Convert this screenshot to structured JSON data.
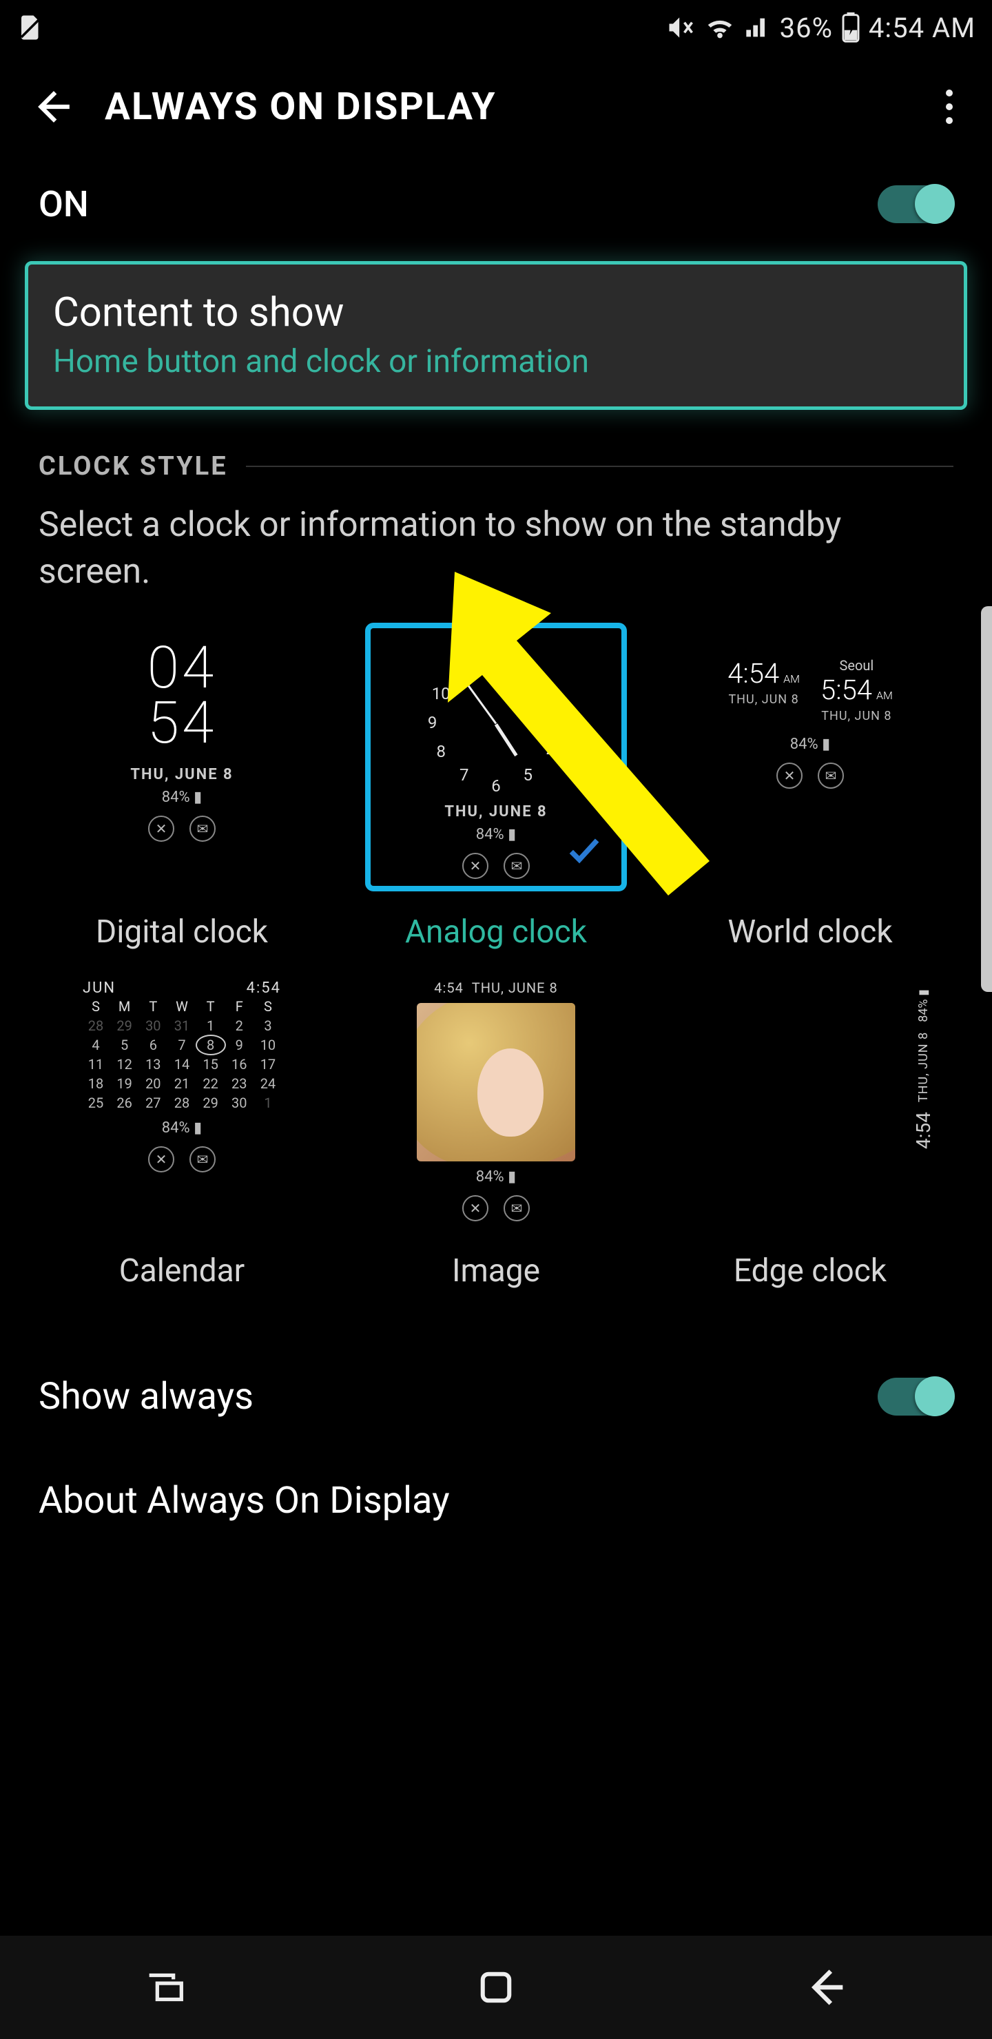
{
  "statusbar": {
    "battery_pct": "36%",
    "time": "4:54 AM"
  },
  "appbar": {
    "title": "ALWAYS ON DISPLAY"
  },
  "main_toggle": {
    "label": "ON",
    "enabled": true
  },
  "content_to_show": {
    "title": "Content to show",
    "subtitle": "Home button and clock or information"
  },
  "section": {
    "label": "CLOCK STYLE",
    "description": "Select a clock or information to show on the standby screen."
  },
  "preview_common": {
    "date": "THU, JUNE 8",
    "date_short": "THU, JUN 8",
    "battery": "84%"
  },
  "styles": [
    {
      "key": "digital",
      "label": "Digital clock",
      "selected": false,
      "time_h": "04",
      "time_m": "54"
    },
    {
      "key": "analog",
      "label": "Analog clock",
      "selected": true
    },
    {
      "key": "world",
      "label": "World clock",
      "selected": false,
      "left": {
        "city": "",
        "time": "4:54",
        "ampm": "AM",
        "date": "THU, JUN 8"
      },
      "right": {
        "city": "Seoul",
        "time": "5:54",
        "ampm": "AM",
        "date": "THU, JUN 8"
      }
    },
    {
      "key": "calendar",
      "label": "Calendar",
      "selected": false,
      "month": "JUN",
      "time": "4:54",
      "dow": [
        "S",
        "M",
        "T",
        "W",
        "T",
        "F",
        "S"
      ],
      "rows": [
        [
          "28",
          "29",
          "30",
          "31",
          "1",
          "2",
          "3"
        ],
        [
          "4",
          "5",
          "6",
          "7",
          "8",
          "9",
          "10"
        ],
        [
          "11",
          "12",
          "13",
          "14",
          "15",
          "16",
          "17"
        ],
        [
          "18",
          "19",
          "20",
          "21",
          "22",
          "23",
          "24"
        ],
        [
          "25",
          "26",
          "27",
          "28",
          "29",
          "30",
          "1"
        ]
      ],
      "today": "8",
      "dim_start_row0": 4,
      "dim_end_row4": 1
    },
    {
      "key": "image",
      "label": "Image",
      "selected": false,
      "head_time": "4:54",
      "head_date": "THU, JUNE 8"
    },
    {
      "key": "edge",
      "label": "Edge clock",
      "selected": false,
      "time": "4:54",
      "date": "THU, JUN 8",
      "battery": "84%"
    }
  ],
  "show_always": {
    "label": "Show always",
    "enabled": true
  },
  "about": {
    "label": "About Always On Display"
  },
  "colors": {
    "accent": "#2fb9a1",
    "selection": "#17b4e8",
    "annotation": "#fff200"
  }
}
